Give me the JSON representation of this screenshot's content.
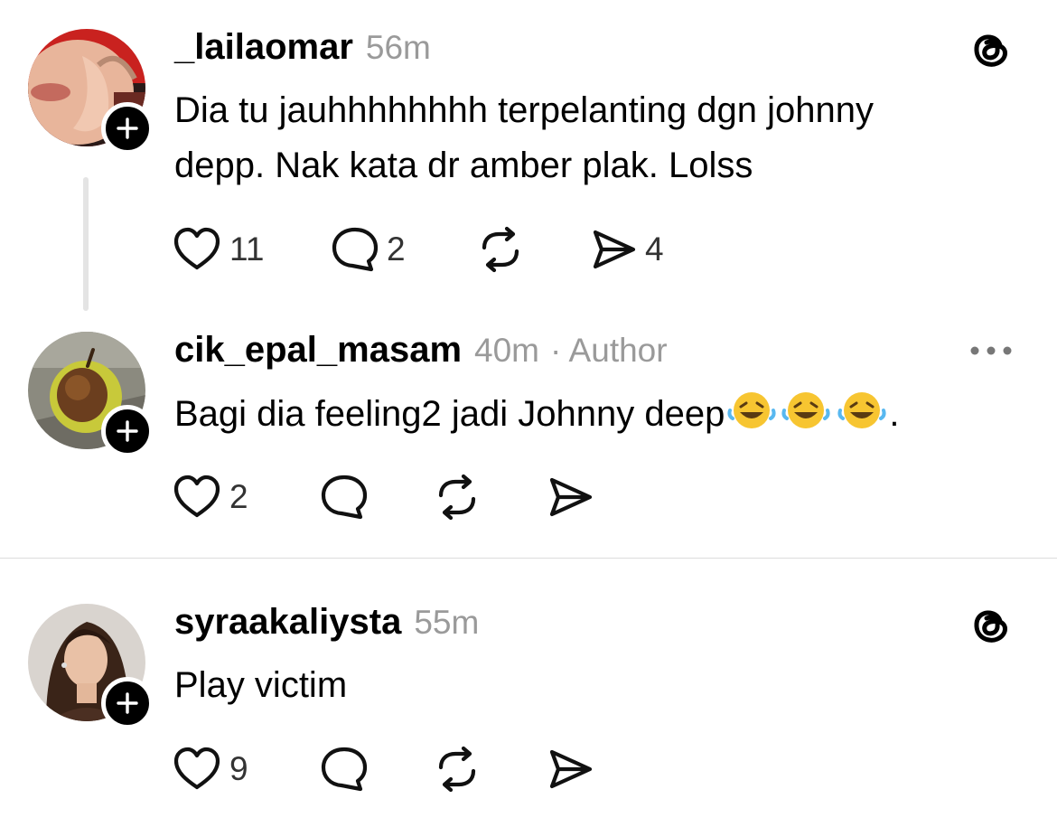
{
  "posts": [
    {
      "username": "_lailaomar",
      "time": "56m",
      "text_lines": [
        "Dia tu jauhhhhhhhh terpelanting dgn johnny",
        "depp. Nak kata dr amber plak. Lolss"
      ],
      "likes": "11",
      "replies": "2",
      "reposts": "",
      "shares": "4",
      "corner_icon": "threads-icon"
    },
    {
      "username": "cik_epal_masam",
      "time": "40m",
      "meta_suffix": "· Author",
      "text": "Bagi dia feeling2 jadi Johnny deep",
      "text_suffix": ".",
      "emojis": [
        "rolling-on-floor-laughing",
        "rolling-on-floor-laughing",
        "rolling-on-floor-laughing"
      ],
      "likes": "2",
      "replies": "",
      "reposts": "",
      "shares": "",
      "corner_icon": "more-icon"
    },
    {
      "username": "syraakaliysta",
      "time": "55m",
      "text": "Play victim",
      "likes": "9",
      "replies": "",
      "reposts": "",
      "shares": "",
      "corner_icon": "threads-icon"
    }
  ],
  "colors": {
    "text": "#000000",
    "meta": "#9a9a9a",
    "count": "#333333",
    "thread_line": "#e4e4e4",
    "divider": "#dcdcdc"
  }
}
